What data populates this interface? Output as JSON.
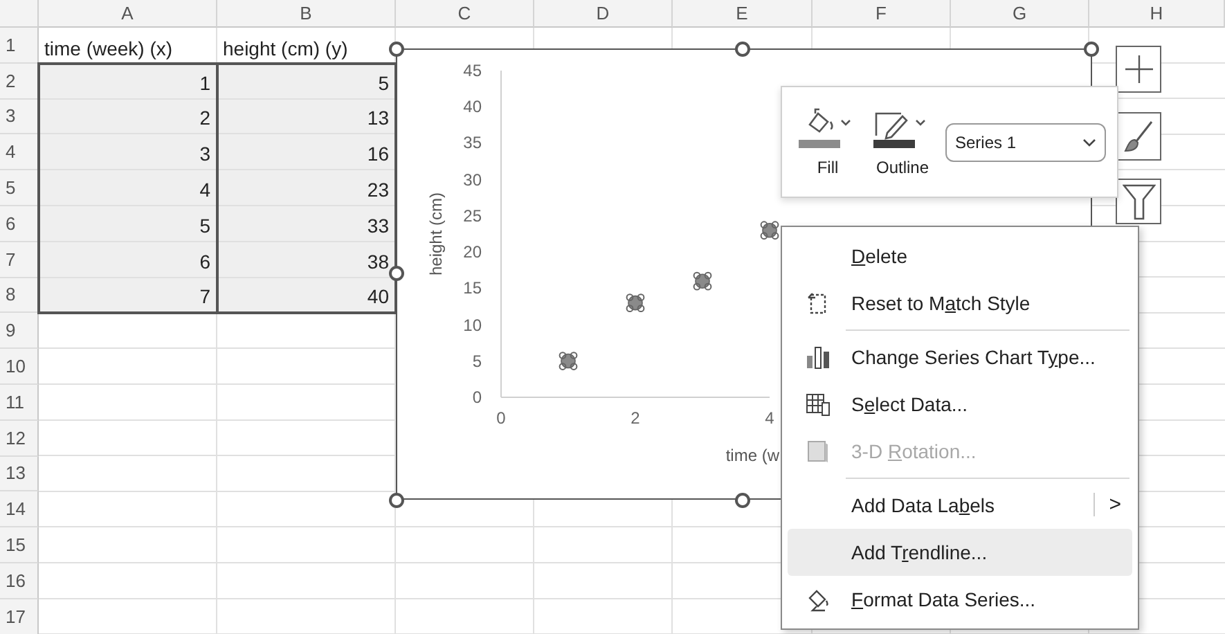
{
  "columns": [
    "A",
    "B",
    "C",
    "D",
    "E",
    "F",
    "G",
    "H"
  ],
  "rows": [
    {
      "number": "1",
      "kind": "label",
      "highlighted": false,
      "cells": [
        "time (week) (x)",
        "height (cm) (y)"
      ]
    },
    {
      "number": "2",
      "kind": "number",
      "highlighted": true,
      "cells": [
        "1",
        "5"
      ]
    },
    {
      "number": "3",
      "kind": "number",
      "highlighted": true,
      "cells": [
        "2",
        "13"
      ]
    },
    {
      "number": "4",
      "kind": "number",
      "highlighted": true,
      "cells": [
        "3",
        "16"
      ]
    },
    {
      "number": "5",
      "kind": "number",
      "highlighted": true,
      "cells": [
        "4",
        "23"
      ]
    },
    {
      "number": "6",
      "kind": "number",
      "highlighted": true,
      "cells": [
        "5",
        "33"
      ]
    },
    {
      "number": "7",
      "kind": "number",
      "highlighted": true,
      "cells": [
        "6",
        "38"
      ]
    },
    {
      "number": "8",
      "kind": "number",
      "highlighted": true,
      "cells": [
        "7",
        "40"
      ]
    },
    {
      "number": "9",
      "kind": "empty",
      "highlighted": false
    },
    {
      "number": "10",
      "kind": "empty",
      "highlighted": false
    },
    {
      "number": "11",
      "kind": "empty",
      "highlighted": false
    },
    {
      "number": "12",
      "kind": "empty",
      "highlighted": false
    },
    {
      "number": "13",
      "kind": "empty",
      "highlighted": false
    },
    {
      "number": "14",
      "kind": "empty",
      "highlighted": false
    },
    {
      "number": "15",
      "kind": "empty",
      "highlighted": false
    },
    {
      "number": "16",
      "kind": "empty",
      "highlighted": false
    },
    {
      "number": "17",
      "kind": "empty",
      "highlighted": false
    }
  ],
  "chart": {
    "chart_data": {
      "type": "scatter",
      "xlabel": "time (w",
      "ylabel": "height (cm)",
      "x": [
        1,
        2,
        3,
        4
      ],
      "series": [
        {
          "color": "#8a8a8a",
          "values": [
            5,
            13,
            16,
            23
          ]
        }
      ],
      "xlim": [
        0,
        4
      ],
      "ylim": [
        0,
        45
      ],
      "xticks": [
        0,
        2,
        4
      ],
      "yticks": [
        0,
        5,
        10,
        15,
        20,
        25,
        30,
        35,
        40,
        45
      ]
    }
  },
  "mini_toolbar": {
    "fill_label": "Fill",
    "outline_label": "Outline",
    "series_select": "Series 1"
  },
  "context_menu": [
    {
      "kind": "item",
      "key": "D",
      "after": "elete",
      "disabled": false,
      "selected": false
    },
    {
      "kind": "item",
      "before": "Reset to M",
      "key": "a",
      "after": "tch Style",
      "disabled": false,
      "selected": false
    },
    {
      "kind": "separator"
    },
    {
      "kind": "item",
      "before": "Change Series Chart T",
      "key": "y",
      "after": "pe...",
      "disabled": false,
      "selected": false
    },
    {
      "kind": "item",
      "before": "S",
      "key": "e",
      "after": "lect Data...",
      "disabled": false,
      "selected": false
    },
    {
      "kind": "item",
      "before": "3-D ",
      "key": "R",
      "after": "otation...",
      "disabled": true,
      "selected": false
    },
    {
      "kind": "separator"
    },
    {
      "kind": "item",
      "before": "Add Data La",
      "key": "b",
      "after": "els",
      "disabled": false,
      "selected": false,
      "submenu_arrow": ">"
    },
    {
      "kind": "item",
      "before": "Add T",
      "key": "r",
      "after": "endline...",
      "disabled": false,
      "selected": true
    },
    {
      "kind": "item",
      "key": "F",
      "after": "ormat Data Series...",
      "disabled": false,
      "selected": false
    }
  ]
}
